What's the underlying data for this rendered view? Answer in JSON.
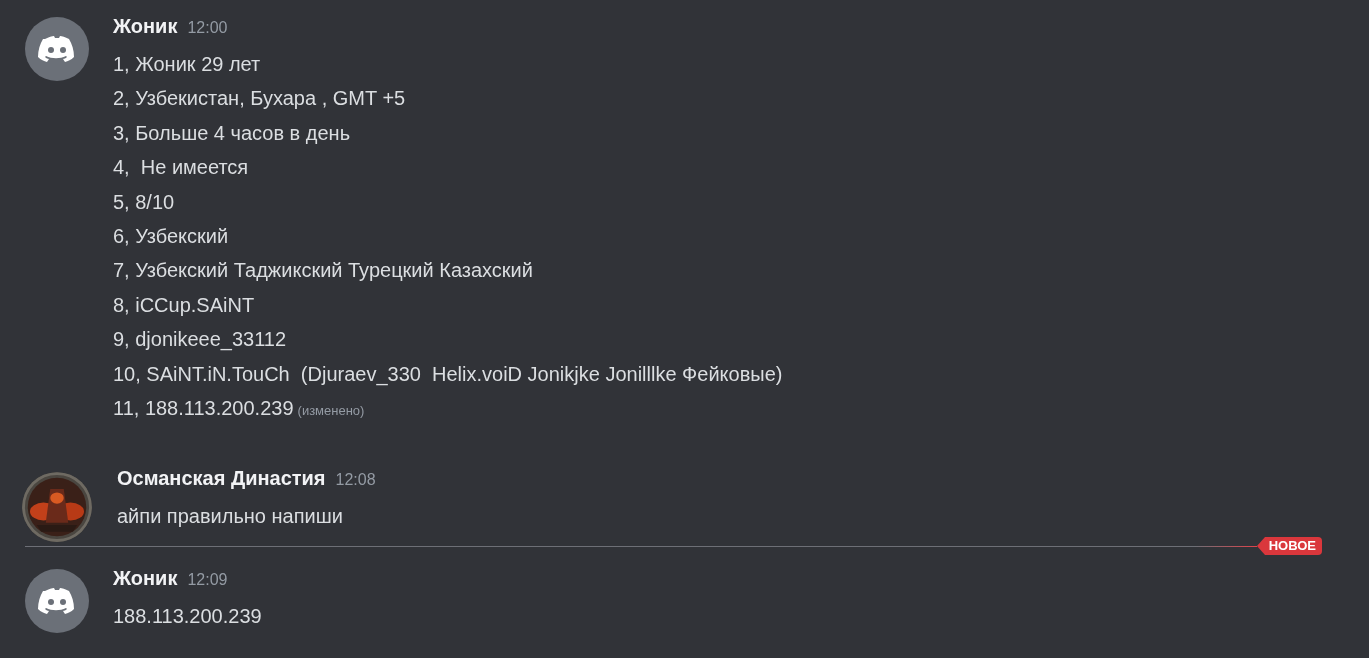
{
  "messages": [
    {
      "kind": "message",
      "custom_avatar": false,
      "author": "Жоник",
      "time": "12:00",
      "lines": [
        "1, Жоник 29 лет",
        "2, Узбекистан, Бухара , GMT +5",
        "3, Больше 4 часов в день",
        "4,  Не имеется",
        "5, 8/10",
        "6, Узбекский",
        "7, Узбекский Таджикский Турецкий Казахский",
        "8, iCCup.SAiNT",
        "9, djonikeee_33112",
        "10, SAiNT.iN.TouCh  (Djuraev_330  Helix.voiD Jonikjke Jonilllke Фейковые)",
        "11, 188.113.200.239"
      ],
      "edited": "(изменено)"
    },
    {
      "kind": "message",
      "custom_avatar": true,
      "author": "Османская Династия",
      "time": "12:08",
      "lines": [
        "айпи правильно напиши"
      ]
    },
    {
      "kind": "divider",
      "label": "НОВОЕ"
    },
    {
      "kind": "message",
      "custom_avatar": false,
      "author": "Жоник",
      "time": "12:09",
      "lines": [
        "188.113.200.239"
      ]
    }
  ]
}
